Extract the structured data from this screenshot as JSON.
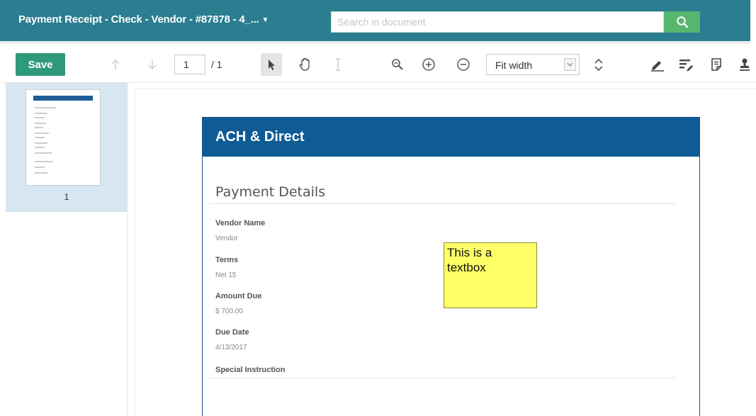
{
  "header": {
    "document_title": "Payment Receipt - Check - Vendor - #87878 - 4_...",
    "search": {
      "placeholder": "Search in document",
      "value": ""
    },
    "colors": {
      "bar": "#2a7e8f",
      "search_button": "#56b56e"
    }
  },
  "toolbar": {
    "save_label": "Save",
    "page_current": "1",
    "page_total": "/ 1",
    "zoom_value": "Fit width",
    "zoom_options": [
      "Fit width"
    ],
    "icons": [
      "prev-page-arrow-up-icon",
      "next-page-arrow-down-icon",
      "select-pointer-icon",
      "pan-hand-icon",
      "text-select-icon",
      "search-zoom-icon",
      "zoom-in-icon",
      "zoom-out-icon",
      "rotate-icon",
      "highlight-pen-icon",
      "text-annotation-icon",
      "note-icon",
      "stamp-icon"
    ],
    "colors": {
      "save_button": "#2f9a7b"
    }
  },
  "sidebar": {
    "thumbnails": [
      {
        "page_number": "1",
        "selected": true
      }
    ],
    "colors": {
      "selected_bg": "#d7e7f2"
    }
  },
  "document": {
    "header_title": "ACH & Direct",
    "section_title": "Payment Details",
    "fields": [
      {
        "label": "Vendor Name",
        "value": "Vendor"
      },
      {
        "label": "Terms",
        "value": "Net 15"
      },
      {
        "label": "Amount Due",
        "value": "$ 700.00"
      },
      {
        "label": "Due Date",
        "value": "4/13/2017"
      },
      {
        "label": "Special Instruction",
        "value": ""
      }
    ],
    "annotation": {
      "type": "textbox",
      "text_line1": "This is a",
      "text_line2": "textbox",
      "fill": "#ffff66"
    },
    "colors": {
      "header_bg": "#0f5b96"
    }
  }
}
